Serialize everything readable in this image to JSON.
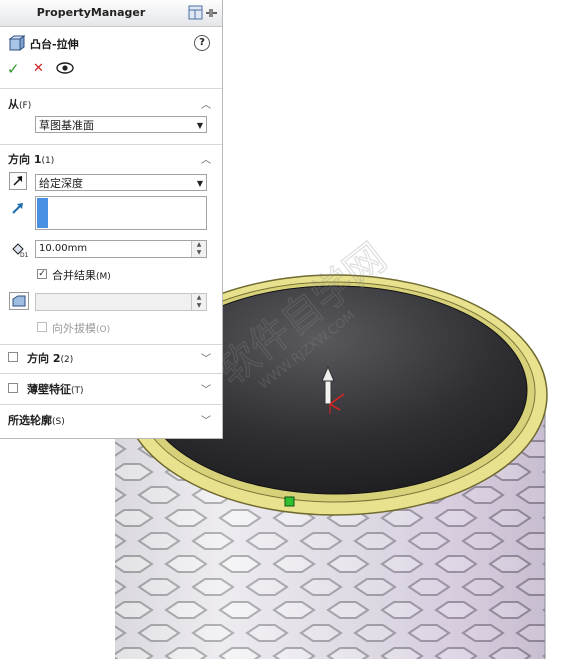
{
  "panel": {
    "title": "PropertyManager",
    "feature_name": "凸台-拉伸",
    "help_glyph": "?",
    "ok_glyph": "✓",
    "cancel_glyph": "✕",
    "preview_glyph": "👁"
  },
  "from": {
    "label": "从",
    "shortcut": "(F)",
    "value": "草图基准面"
  },
  "direction1": {
    "label": "方向 1",
    "shortcut": "(1)",
    "end_condition": "给定深度",
    "depth_value": "10.00mm",
    "merge_label": "合并结果",
    "merge_shortcut": "(M)",
    "merge_checked": true,
    "draft_outward_label": "向外拔模",
    "draft_outward_shortcut": "(O)",
    "draft_outward_checked": false
  },
  "direction2": {
    "label": "方向 2",
    "shortcut": "(2)",
    "checked": false
  },
  "thin_feature": {
    "label": "薄壁特征",
    "shortcut": "(T)",
    "checked": false
  },
  "selected_contours": {
    "label": "所选轮廓",
    "shortcut": "(S)"
  },
  "watermark": {
    "main": "软件自学网",
    "url": "WWW.RJZXW.COM"
  },
  "colors": {
    "rim_yellow": "#e6e08a",
    "inner_dark": "#2e2e30",
    "ok_green": "#2e9a2e",
    "cancel_red": "#d22222",
    "highlight_blue": "#4a90e2"
  }
}
